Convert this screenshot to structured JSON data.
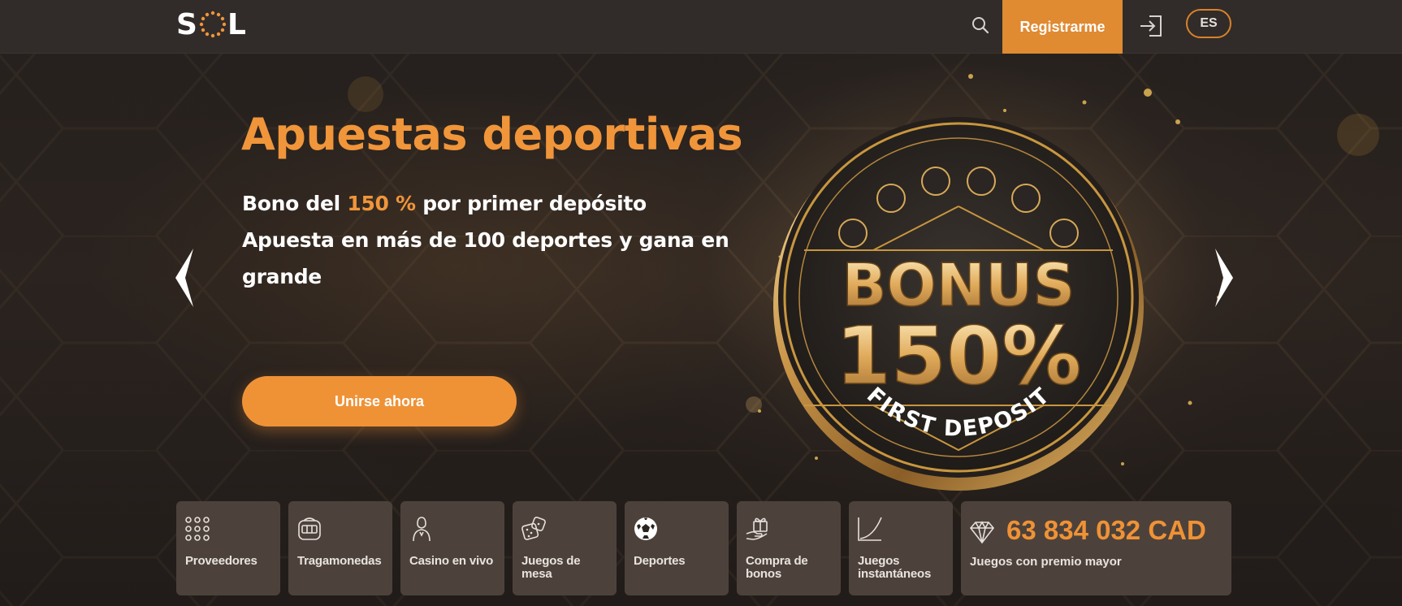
{
  "header": {
    "logo_text": "SOL",
    "register_label": "Registrarme",
    "language": "ES",
    "icons": {
      "search": "search-icon",
      "login": "login-icon"
    }
  },
  "hero": {
    "title": "Apuestas deportivas",
    "subtitle_prefix": "Bono del ",
    "subtitle_highlight": "150 %",
    "subtitle_suffix": " por primer depósito",
    "subtitle_line2": "Apuesta en más de 100 deportes y gana en grande",
    "cta_label": "Unirse ahora",
    "coin": {
      "word": "BONUS",
      "percent": "150%",
      "caption": "FIRST DEPOSIT"
    }
  },
  "categories": [
    {
      "label": "Proveedores",
      "icon": "providers-grid-icon"
    },
    {
      "label": "Tragamonedas",
      "icon": "slot-machine-icon"
    },
    {
      "label": "Casino en vivo",
      "icon": "live-dealer-icon"
    },
    {
      "label": "Juegos de mesa",
      "icon": "dice-icon"
    },
    {
      "label": "Deportes",
      "icon": "soccer-ball-icon"
    },
    {
      "label": "Compra de bonos",
      "icon": "gift-hand-icon"
    },
    {
      "label": "Juegos instantáneos",
      "icon": "rising-curve-icon"
    }
  ],
  "jackpot": {
    "amount": "63 834 032 CAD",
    "label": "Juegos con premio mayor",
    "icon": "diamond-icon"
  },
  "colors": {
    "accent": "#ef9236",
    "header_bg": "#312c29",
    "tile_bg": "#4d423b",
    "page_bg": "#2a2421"
  }
}
